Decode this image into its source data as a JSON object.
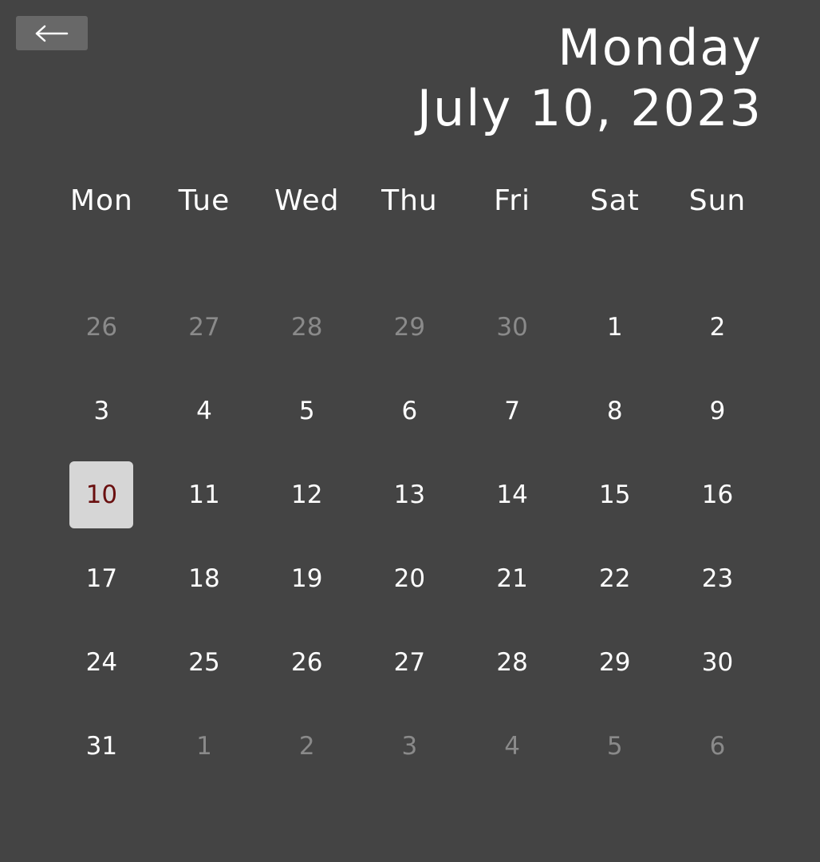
{
  "header": {
    "weekday": "Monday",
    "date": "July 10, 2023"
  },
  "back_button": {
    "icon": "arrow-left-icon"
  },
  "weekdays": [
    "Mon",
    "Tue",
    "Wed",
    "Thu",
    "Fri",
    "Sat",
    "Sun"
  ],
  "colors": {
    "background": "#444444",
    "text": "#ffffff",
    "muted_text": "#8a8a8a",
    "selected_bg": "#d6d6d6",
    "selected_text": "#6a0f0f",
    "button_bg": "#686868"
  },
  "days": [
    {
      "label": "26",
      "current_month": false
    },
    {
      "label": "27",
      "current_month": false
    },
    {
      "label": "28",
      "current_month": false
    },
    {
      "label": "29",
      "current_month": false
    },
    {
      "label": "30",
      "current_month": false
    },
    {
      "label": "1",
      "current_month": true
    },
    {
      "label": "2",
      "current_month": true
    },
    {
      "label": "3",
      "current_month": true
    },
    {
      "label": "4",
      "current_month": true
    },
    {
      "label": "5",
      "current_month": true
    },
    {
      "label": "6",
      "current_month": true
    },
    {
      "label": "7",
      "current_month": true
    },
    {
      "label": "8",
      "current_month": true
    },
    {
      "label": "9",
      "current_month": true
    },
    {
      "label": "10",
      "current_month": true,
      "selected": true
    },
    {
      "label": "11",
      "current_month": true
    },
    {
      "label": "12",
      "current_month": true
    },
    {
      "label": "13",
      "current_month": true
    },
    {
      "label": "14",
      "current_month": true
    },
    {
      "label": "15",
      "current_month": true
    },
    {
      "label": "16",
      "current_month": true
    },
    {
      "label": "17",
      "current_month": true
    },
    {
      "label": "18",
      "current_month": true
    },
    {
      "label": "19",
      "current_month": true
    },
    {
      "label": "20",
      "current_month": true
    },
    {
      "label": "21",
      "current_month": true
    },
    {
      "label": "22",
      "current_month": true
    },
    {
      "label": "23",
      "current_month": true
    },
    {
      "label": "24",
      "current_month": true
    },
    {
      "label": "25",
      "current_month": true
    },
    {
      "label": "26",
      "current_month": true
    },
    {
      "label": "27",
      "current_month": true
    },
    {
      "label": "28",
      "current_month": true
    },
    {
      "label": "29",
      "current_month": true
    },
    {
      "label": "30",
      "current_month": true
    },
    {
      "label": "31",
      "current_month": true
    },
    {
      "label": "1",
      "current_month": false
    },
    {
      "label": "2",
      "current_month": false
    },
    {
      "label": "3",
      "current_month": false
    },
    {
      "label": "4",
      "current_month": false
    },
    {
      "label": "5",
      "current_month": false
    },
    {
      "label": "6",
      "current_month": false
    }
  ]
}
